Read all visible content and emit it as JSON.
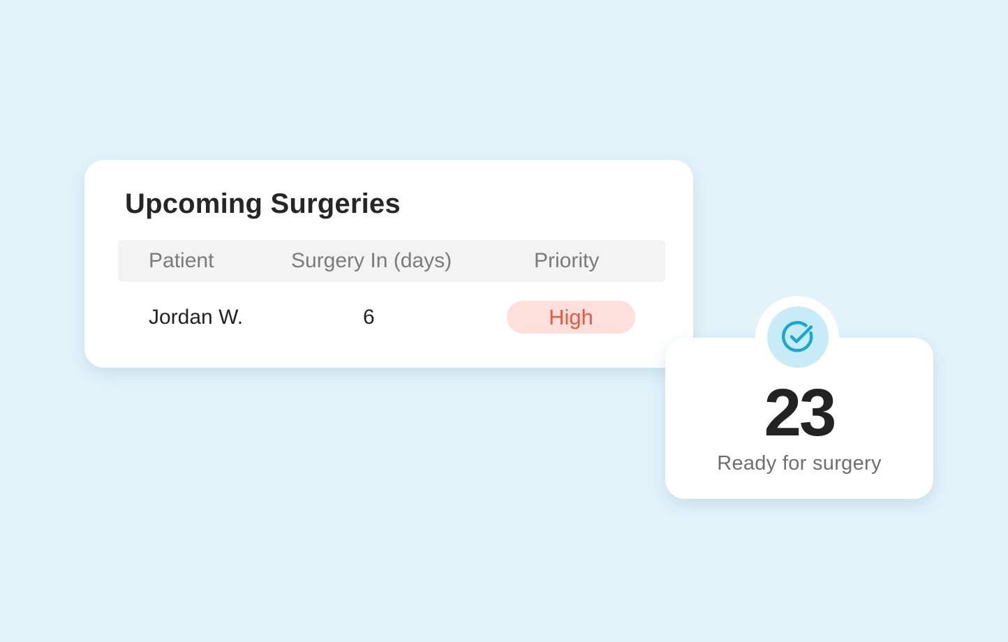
{
  "surgeries_card": {
    "title": "Upcoming Surgeries",
    "columns": [
      "Patient",
      "Surgery In (days)",
      "Priority"
    ],
    "rows": [
      {
        "patient": "Jordan W.",
        "days": "6",
        "priority": "High"
      }
    ]
  },
  "stat_card": {
    "value": "23",
    "label": "Ready for surgery",
    "icon": "check-circle-icon"
  },
  "colors": {
    "background": "#e2f3fa",
    "priority_high_bg": "#fde0dc",
    "priority_high_text": "#f0563c",
    "icon_bg": "#c7ecf8",
    "icon_accent": "#1aa8cf"
  }
}
